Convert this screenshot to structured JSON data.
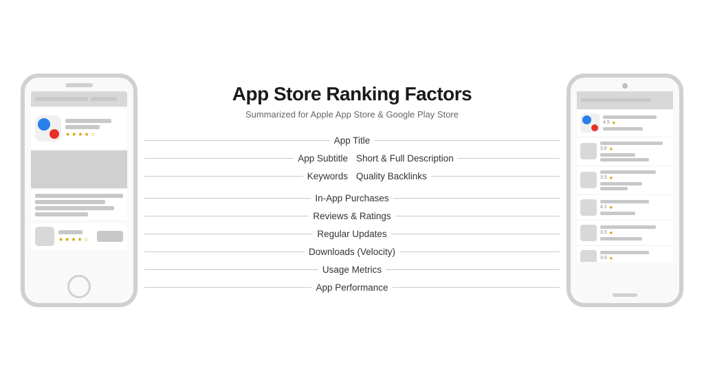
{
  "header": {
    "title": "App Store Ranking Factors",
    "subtitle": "Summarized for Apple App Store & Google Play Store"
  },
  "factors": {
    "app_title": "App Title",
    "app_subtitle": "App Subtitle",
    "keywords": "Keywords",
    "short_full_description": "Short & Full Description",
    "quality_backlinks": "Quality Backlinks",
    "in_app_purchases": "In-App Purchases",
    "reviews_ratings": "Reviews & Ratings",
    "regular_updates": "Regular Updates",
    "downloads_velocity": "Downloads (Velocity)",
    "usage_metrics": "Usage Metrics",
    "app_performance": "App Performance"
  },
  "android_ratings": [
    "4.5",
    "3.8",
    "3.5",
    "4.2",
    "3.9",
    "3.9"
  ],
  "icons": {
    "star": "★"
  }
}
